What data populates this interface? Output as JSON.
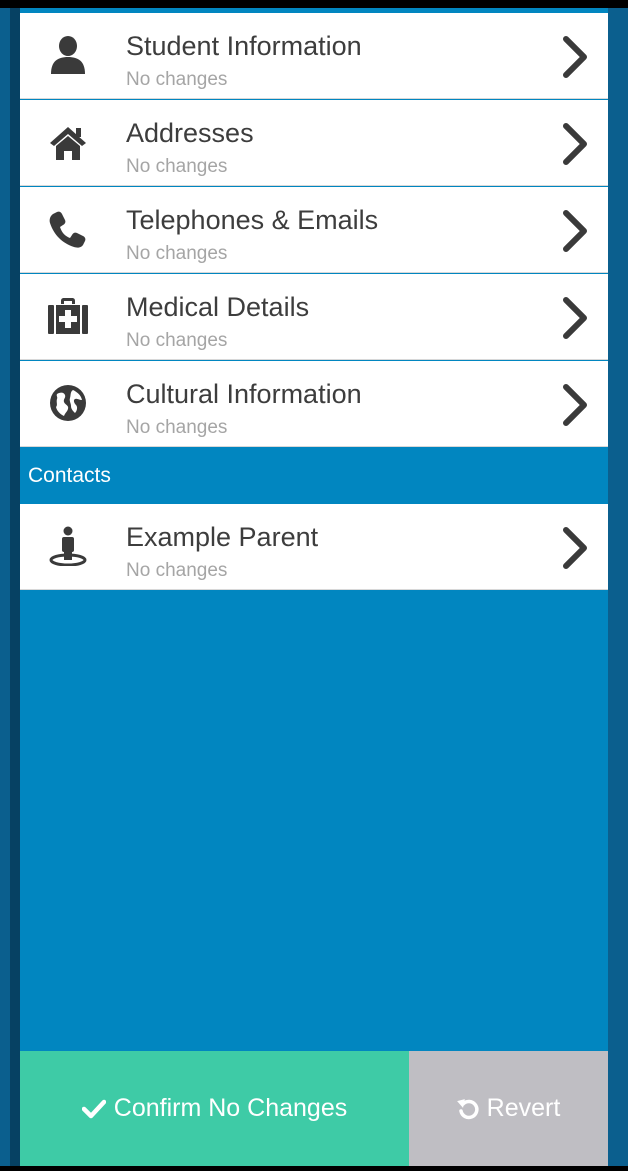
{
  "records": [
    {
      "title": "Student Information",
      "status": "No changes",
      "icon": "user-icon"
    },
    {
      "title": "Addresses",
      "status": "No changes",
      "icon": "home-icon"
    },
    {
      "title": "Telephones & Emails",
      "status": "No changes",
      "icon": "phone-icon"
    },
    {
      "title": "Medical Details",
      "status": "No changes",
      "icon": "medkit-icon"
    },
    {
      "title": "Cultural Information",
      "status": "No changes",
      "icon": "globe-icon"
    }
  ],
  "contacts_section": {
    "label": "Contacts",
    "items": [
      {
        "title": "Example Parent",
        "status": "No changes",
        "icon": "contact-person-icon"
      }
    ]
  },
  "footer": {
    "confirm_label": "Confirm No Changes",
    "confirm_icon": "checkmark-icon",
    "revert_label": "Revert",
    "revert_icon": "undo-icon"
  },
  "colors": {
    "panel_blue": "#0186c0",
    "confirm_green": "#3ecba6",
    "revert_gray": "#bfbec3",
    "title_text": "#3d3d3d",
    "status_text": "#a5a5a5",
    "icon_dark": "#3a3a3a"
  }
}
